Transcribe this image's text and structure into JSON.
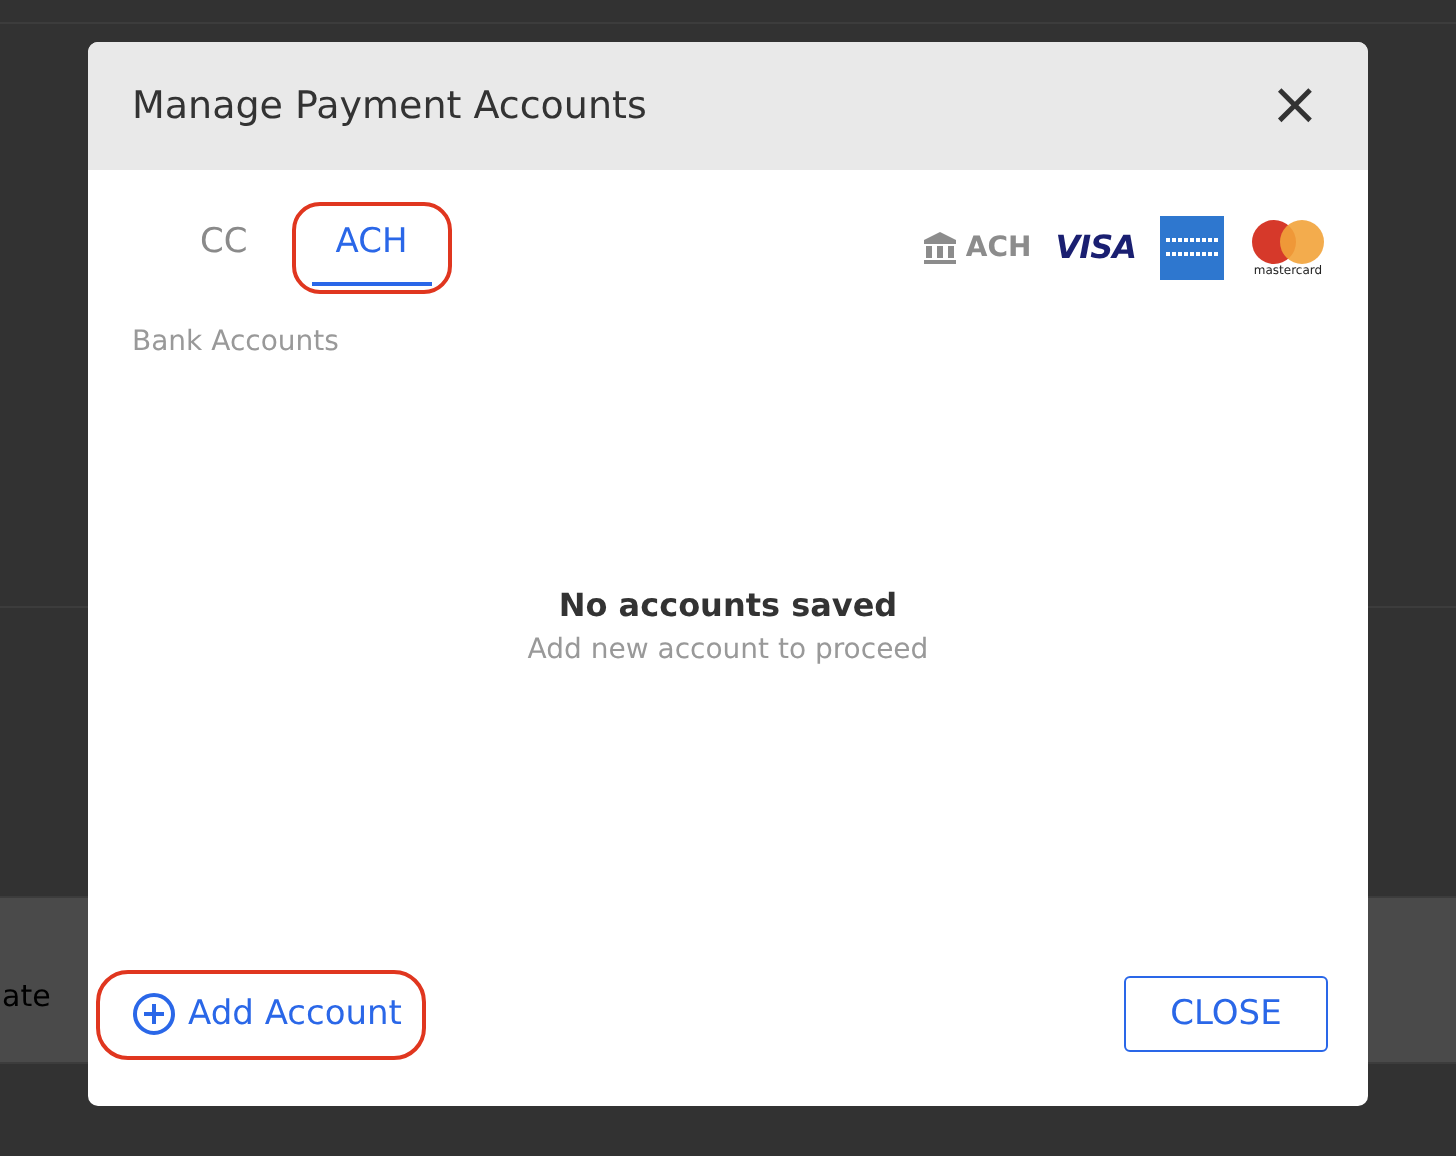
{
  "background": {
    "text": "ate"
  },
  "modal": {
    "title": "Manage Payment Accounts",
    "close_icon": "×",
    "tabs": [
      {
        "label": "CC",
        "selected": false,
        "highlighted": false
      },
      {
        "label": "ACH",
        "selected": true,
        "highlighted": true
      }
    ],
    "payment_methods": [
      {
        "kind": "ach",
        "label": "ACH"
      },
      {
        "kind": "visa",
        "label": "VISA"
      },
      {
        "kind": "amex"
      },
      {
        "kind": "mastercard",
        "label": "mastercard"
      }
    ],
    "section_label": "Bank Accounts",
    "empty_state": {
      "title": "No accounts saved",
      "subtitle": "Add new account to proceed"
    },
    "add_button": {
      "label": "Add Account",
      "highlighted": true
    },
    "close_button": {
      "label": "CLOSE"
    }
  }
}
